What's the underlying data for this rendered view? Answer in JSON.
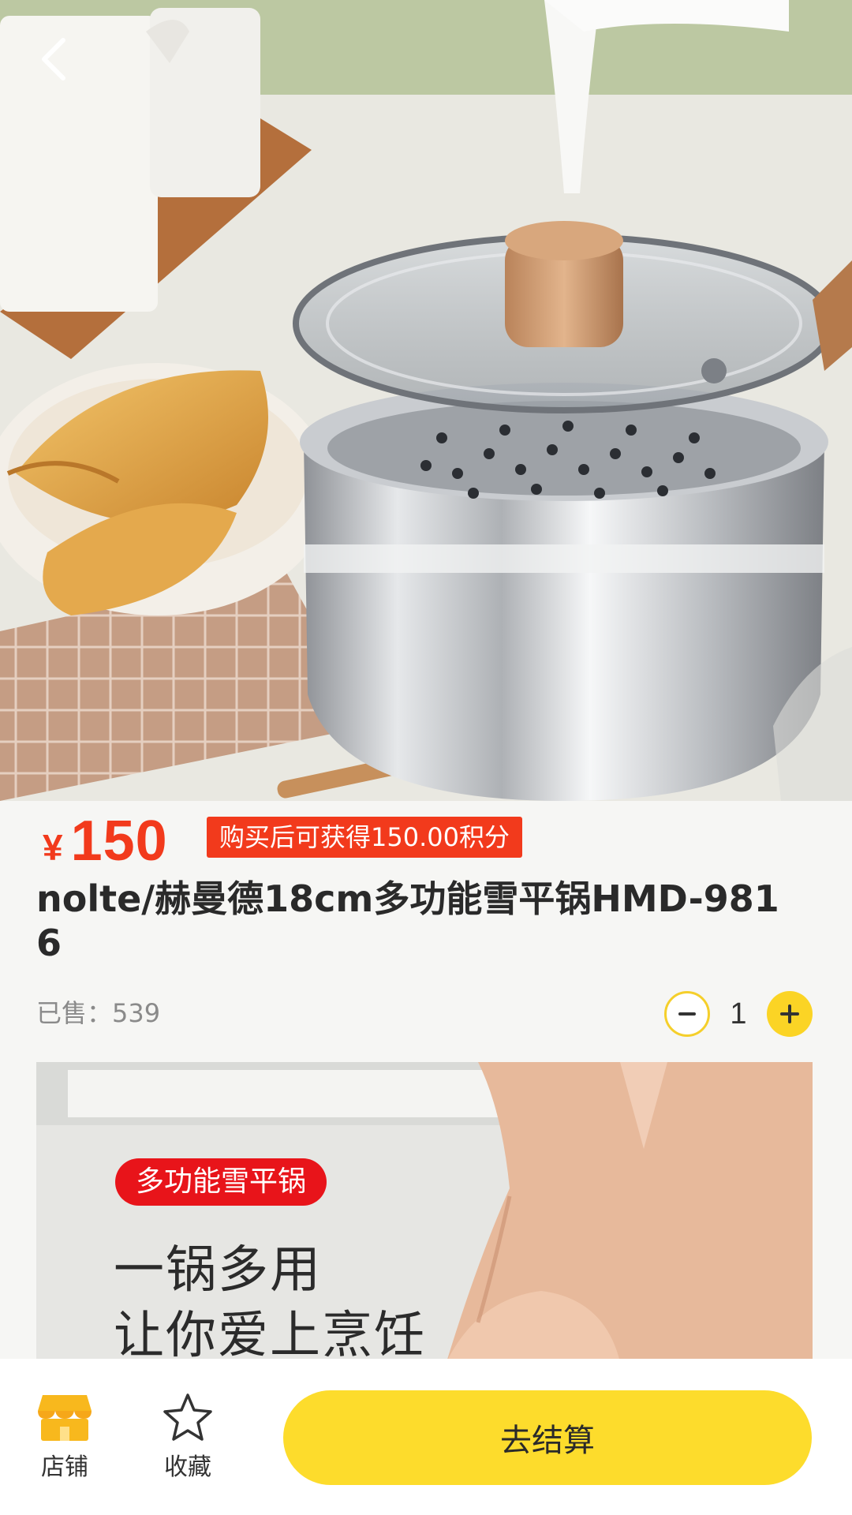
{
  "product": {
    "currency": "¥",
    "price": "150",
    "points_tag": "购买后可获得150.00积分",
    "title": "nolte/赫曼德18cm多功能雪平锅HMD-9816",
    "sold": "已售：539",
    "quantity": "1"
  },
  "detail_banner": {
    "tag": "多功能雪平锅",
    "line1": "一锅多用",
    "line2": "让你爱上烹饪"
  },
  "bottom_bar": {
    "shop_label": "店铺",
    "favorite_label": "收藏",
    "checkout_label": "去结算"
  },
  "icons": {
    "back": "chevron-left-icon",
    "minus": "minus-icon",
    "plus": "plus-icon",
    "shop": "shop-icon",
    "favorite": "star-icon"
  },
  "colors": {
    "price_red": "#f23a1c",
    "accent_yellow": "#fddc2c",
    "page_bg": "#f6f6f4"
  }
}
